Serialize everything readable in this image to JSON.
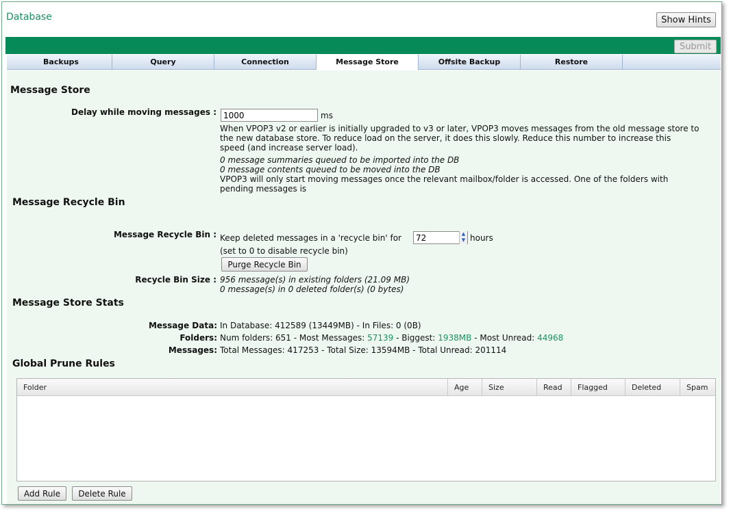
{
  "window": {
    "title": "Database",
    "hints_label": "Show Hints",
    "submit_label": "Submit"
  },
  "tabs": [
    {
      "label": "Backups"
    },
    {
      "label": "Query"
    },
    {
      "label": "Connection"
    },
    {
      "label": "Message Store",
      "active": true
    },
    {
      "label": "Offsite Backup"
    },
    {
      "label": "Restore"
    }
  ],
  "message_store": {
    "heading": "Message Store",
    "delay_label": "Delay while moving messages :",
    "delay_value": "1000",
    "delay_unit": "ms",
    "desc_line1": "When VPOP3 v2 or earlier is initially upgraded to v3 or later, VPOP3 moves messages from the old message store to",
    "desc_line2": "the new database store. To reduce load on the server, it does this slowly. Reduce this number to increase this",
    "desc_line3": "speed (and increase server load).",
    "queued_summaries": "0 message summaries queued to be imported into the DB",
    "queued_contents": "0 message contents queued to be moved into the DB",
    "start_note_line1": "VPOP3 will only start moving messages once the relevant mailbox/folder is accessed. One of the folders with",
    "start_note_line2": "pending messages is"
  },
  "recycle_bin": {
    "heading": "Message Recycle Bin",
    "label": "Message Recycle Bin :",
    "keep_prefix": "Keep deleted messages in a 'recycle bin' for",
    "hours_value": "72",
    "hours_unit": "hours",
    "disable_note": "(set to 0 to disable recycle bin)",
    "purge_label": "Purge Recycle Bin",
    "size_label": "Recycle Bin Size :",
    "size_existing": "956 message(s) in existing folders (21.09 MB)",
    "size_deleted": "0 message(s) in 0 deleted folder(s) (0 bytes)"
  },
  "stats": {
    "heading": "Message Store Stats",
    "data_label": "Message Data:",
    "data_value": "In Database: 412589 (13449MB) - In Files: 0 (0B)",
    "folders_label": "Folders:",
    "folders_prefix": "Num folders: 651 - Most Messages:",
    "most_messages": "57139",
    "biggest_prefix": "- Biggest:",
    "biggest": "1938MB",
    "unread_prefix": "- Most Unread:",
    "most_unread": "44968",
    "messages_label": "Messages:",
    "messages_value": "Total Messages: 417253 - Total Size: 13594MB - Total Unread: 201114"
  },
  "prune": {
    "heading": "Global Prune Rules",
    "columns": [
      "Folder",
      "Age",
      "Size",
      "Read",
      "Flagged",
      "Deleted",
      "Spam"
    ],
    "add_label": "Add Rule",
    "delete_label": "Delete Rule"
  },
  "colors": {
    "accent": "#068a57",
    "link_green": "#1a9060",
    "content_bg": "#eef7f0"
  }
}
